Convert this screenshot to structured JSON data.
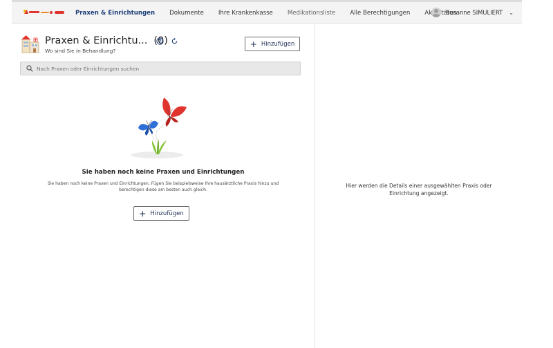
{
  "header": {
    "logo_alt": "Patient-Modul",
    "nav": [
      {
        "label": "Praxen & Einrichtungen",
        "active": true
      },
      {
        "label": "Dokumente"
      },
      {
        "label": "Ihre Krankenkasse"
      },
      {
        "label": "Medikationsliste",
        "muted": true
      },
      {
        "label": "Alle Berechtigungen"
      },
      {
        "label": "Aktivitäten"
      }
    ],
    "user": {
      "name": "Susanne SIMULIERT"
    }
  },
  "panel": {
    "title": "Praxen & Einrichtu...",
    "count": "(0)",
    "subtitle": "Wo sind Sie in Behandlung?",
    "add_label": "Hinzufügen"
  },
  "search": {
    "placeholder": "Nach Praxen oder Einrichtungen suchen"
  },
  "empty_state": {
    "title": "Sie haben noch keine Praxen und Einrichtungen",
    "text": "Sie haben noch keine Praxen und Einrichtungen. Fügen Sie beispielsweise Ihre hausärztliche Praxis hinzu und berechtigen diese am besten auch gleich.",
    "add_label": "Hinzufügen"
  },
  "detail": {
    "placeholder": "Hier werden die Details einer ausgewählten Praxis oder Einrichtung angezeigt."
  },
  "colors": {
    "accent": "#1f3f78",
    "butterfly_red": "#e0342f",
    "butterfly_blue": "#2f6fd8",
    "leaf_green": "#8cc63e"
  }
}
